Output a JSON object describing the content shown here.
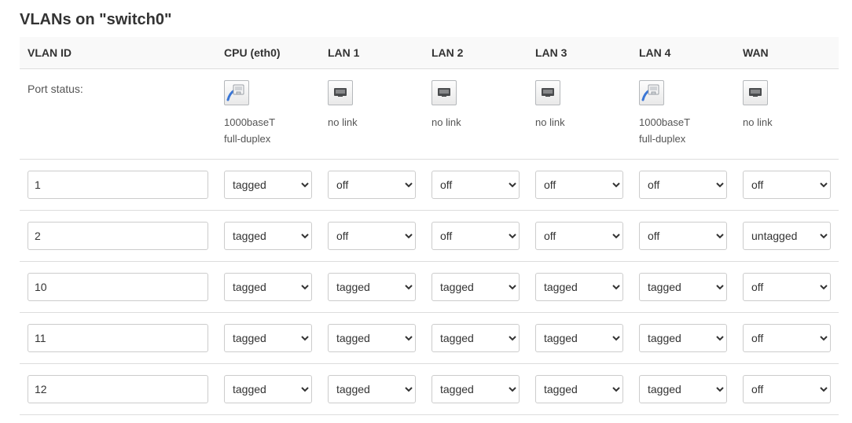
{
  "title": "VLANs on \"switch0\"",
  "options": {
    "off": "off",
    "tagged": "tagged",
    "untagged": "untagged"
  },
  "headers": {
    "vlan_id": "VLAN ID",
    "port_status_label": "Port status:",
    "ports": [
      {
        "key": "cpu",
        "label": "CPU (eth0)",
        "connected": true,
        "status1": "1000baseT",
        "status2": "full-duplex"
      },
      {
        "key": "lan1",
        "label": "LAN 1",
        "connected": false,
        "status1": "no link",
        "status2": ""
      },
      {
        "key": "lan2",
        "label": "LAN 2",
        "connected": false,
        "status1": "no link",
        "status2": ""
      },
      {
        "key": "lan3",
        "label": "LAN 3",
        "connected": false,
        "status1": "no link",
        "status2": ""
      },
      {
        "key": "lan4",
        "label": "LAN 4",
        "connected": true,
        "status1": "1000baseT",
        "status2": "full-duplex"
      },
      {
        "key": "wan",
        "label": "WAN",
        "connected": false,
        "status1": "no link",
        "status2": ""
      }
    ]
  },
  "rows": [
    {
      "id": "1",
      "values": [
        "tagged",
        "off",
        "off",
        "off",
        "off",
        "off"
      ]
    },
    {
      "id": "2",
      "values": [
        "tagged",
        "off",
        "off",
        "off",
        "off",
        "untagged"
      ]
    },
    {
      "id": "10",
      "values": [
        "tagged",
        "tagged",
        "tagged",
        "tagged",
        "tagged",
        "off"
      ]
    },
    {
      "id": "11",
      "values": [
        "tagged",
        "tagged",
        "tagged",
        "tagged",
        "tagged",
        "off"
      ]
    },
    {
      "id": "12",
      "values": [
        "tagged",
        "tagged",
        "tagged",
        "tagged",
        "tagged",
        "off"
      ]
    }
  ]
}
